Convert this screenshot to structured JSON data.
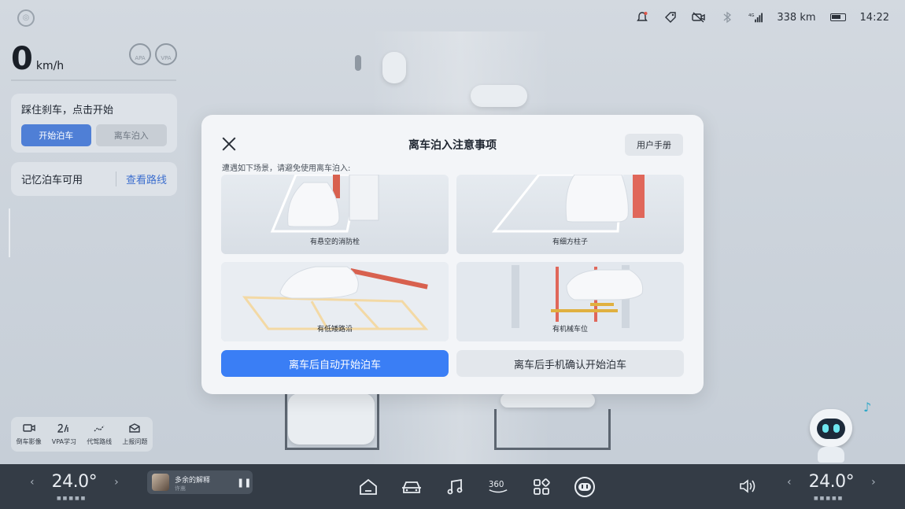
{
  "status_bar": {
    "distance": "338 km",
    "time": "14:22",
    "signal": "4G"
  },
  "left_panel": {
    "speed": "0",
    "speed_unit": "km/h",
    "badge_apa": "APA",
    "badge_vpa": "VPA",
    "brake_prompt": "踩住刹车，点击开始",
    "start_parking": "开始泊车",
    "leave_parking": "离车泊入",
    "memory_parking": "记忆泊车可用",
    "view_route": "查看路线"
  },
  "tools": [
    {
      "icon": "camera-icon",
      "label": "倒车影像"
    },
    {
      "icon": "learn-icon",
      "label": "VPA学习"
    },
    {
      "icon": "route-icon",
      "label": "代驾路线"
    },
    {
      "icon": "report-icon",
      "label": "上报问题"
    }
  ],
  "dialog": {
    "title": "离车泊入注意事项",
    "manual": "用户手册",
    "subtitle": "遭遇如下场景，请避免使用离车泊入:",
    "tiles": [
      {
        "caption": "有悬空的消防栓"
      },
      {
        "caption": "有细方柱子"
      },
      {
        "caption": "有低矮路沿"
      },
      {
        "caption": "有机械车位"
      }
    ],
    "primary_action": "离车后自动开始泊车",
    "secondary_action": "离车后手机确认开始泊车"
  },
  "dock": {
    "left_temp": "24.0°",
    "right_temp": "24.0°",
    "song": "多余的解释",
    "artist": "许嵩"
  },
  "colors": {
    "primary_blue": "#3a7ef5",
    "dock_bg": "#343c46",
    "warning_red": "#e0564a"
  }
}
